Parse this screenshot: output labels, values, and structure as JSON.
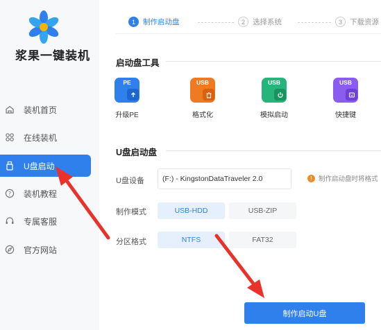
{
  "app": {
    "brand": "浆果一键装机"
  },
  "sidebar": {
    "items": [
      {
        "label": "装机首页",
        "icon": "home-icon",
        "active": false
      },
      {
        "label": "在线装机",
        "icon": "cube-icon",
        "active": false
      },
      {
        "label": "U盘启动",
        "icon": "usb-icon",
        "active": true
      },
      {
        "label": "装机教程",
        "icon": "help-icon",
        "active": false
      },
      {
        "label": "专属客服",
        "icon": "headset-icon",
        "active": false
      },
      {
        "label": "官方网站",
        "icon": "compass-icon",
        "active": false
      }
    ]
  },
  "steps": [
    {
      "num": "1",
      "label": "制作启动盘",
      "active": true
    },
    {
      "num": "2",
      "label": "选择系统",
      "active": false
    },
    {
      "num": "3",
      "label": "下载资源",
      "active": false
    }
  ],
  "tools_section": {
    "title": "启动盘工具",
    "items": [
      {
        "tag": "PE",
        "label": "升级PE",
        "color": "#2f80ed",
        "icon": "upload-icon"
      },
      {
        "tag": "USB",
        "label": "格式化",
        "color": "#f07a22",
        "icon": "trash-icon"
      },
      {
        "tag": "USB",
        "label": "模拟启动",
        "color": "#26b47a",
        "icon": "power-icon"
      },
      {
        "tag": "USB",
        "label": "快捷键",
        "color": "#8a5cf0",
        "icon": "keyboard-icon"
      }
    ]
  },
  "usb_section": {
    "title": "U盘启动盘",
    "device_label": "U盘设备",
    "device_value": "(F:) - KingstonDataTraveler 2.0",
    "warning": "制作启动盘时将格式",
    "mode_label": "制作模式",
    "modes": [
      {
        "label": "USB-HDD",
        "selected": true
      },
      {
        "label": "USB-ZIP",
        "selected": false
      }
    ],
    "format_label": "分区格式",
    "formats": [
      {
        "label": "NTFS",
        "selected": true
      },
      {
        "label": "FAT32",
        "selected": false
      }
    ],
    "make_button": "制作启动U盘"
  },
  "colors": {
    "accent": "#2f80ed",
    "annotation": "#e8322b",
    "warning": "#f08c28"
  }
}
